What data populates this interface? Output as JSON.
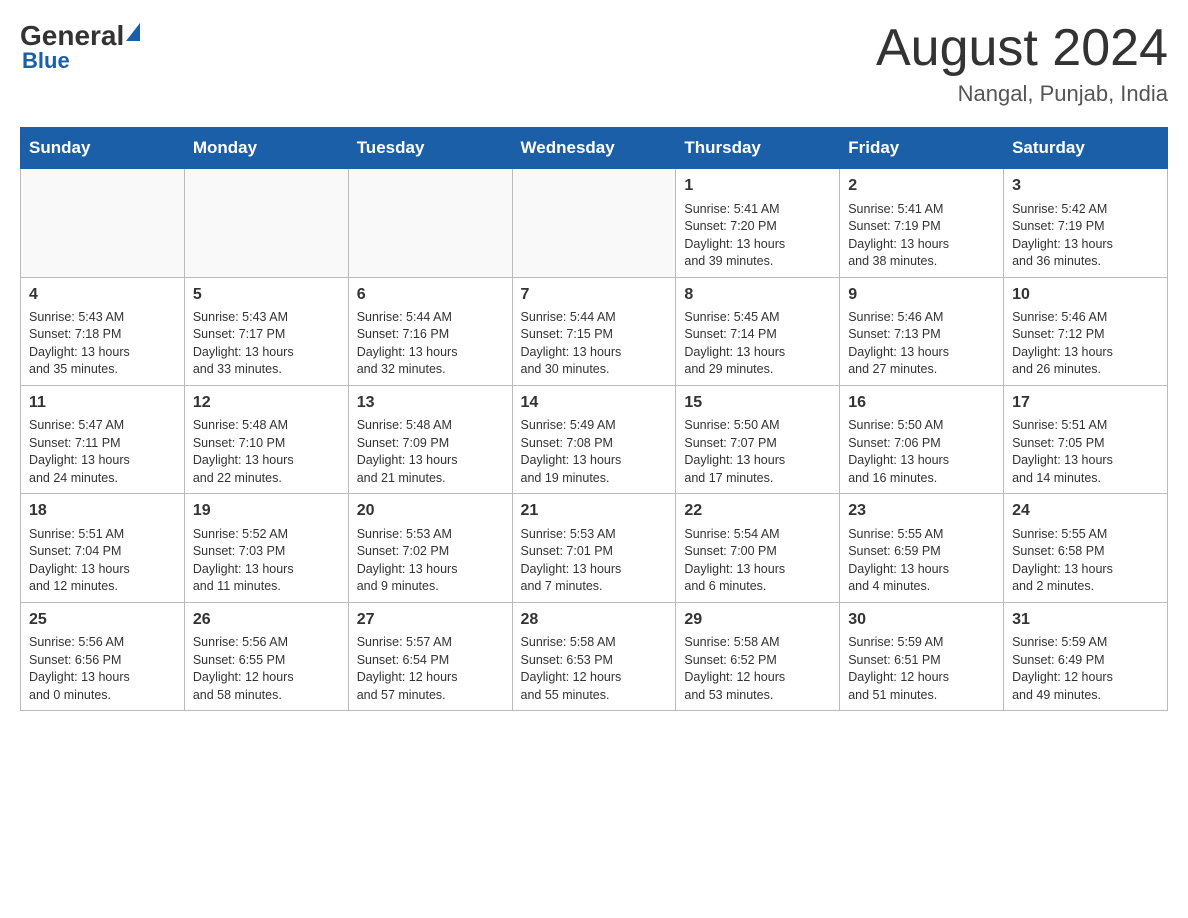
{
  "header": {
    "logo": {
      "general": "General",
      "blue": "Blue"
    },
    "title": "August 2024",
    "location": "Nangal, Punjab, India"
  },
  "calendar": {
    "days": [
      "Sunday",
      "Monday",
      "Tuesday",
      "Wednesday",
      "Thursday",
      "Friday",
      "Saturday"
    ],
    "weeks": [
      [
        {
          "day": "",
          "info": ""
        },
        {
          "day": "",
          "info": ""
        },
        {
          "day": "",
          "info": ""
        },
        {
          "day": "",
          "info": ""
        },
        {
          "day": "1",
          "info": "Sunrise: 5:41 AM\nSunset: 7:20 PM\nDaylight: 13 hours\nand 39 minutes."
        },
        {
          "day": "2",
          "info": "Sunrise: 5:41 AM\nSunset: 7:19 PM\nDaylight: 13 hours\nand 38 minutes."
        },
        {
          "day": "3",
          "info": "Sunrise: 5:42 AM\nSunset: 7:19 PM\nDaylight: 13 hours\nand 36 minutes."
        }
      ],
      [
        {
          "day": "4",
          "info": "Sunrise: 5:43 AM\nSunset: 7:18 PM\nDaylight: 13 hours\nand 35 minutes."
        },
        {
          "day": "5",
          "info": "Sunrise: 5:43 AM\nSunset: 7:17 PM\nDaylight: 13 hours\nand 33 minutes."
        },
        {
          "day": "6",
          "info": "Sunrise: 5:44 AM\nSunset: 7:16 PM\nDaylight: 13 hours\nand 32 minutes."
        },
        {
          "day": "7",
          "info": "Sunrise: 5:44 AM\nSunset: 7:15 PM\nDaylight: 13 hours\nand 30 minutes."
        },
        {
          "day": "8",
          "info": "Sunrise: 5:45 AM\nSunset: 7:14 PM\nDaylight: 13 hours\nand 29 minutes."
        },
        {
          "day": "9",
          "info": "Sunrise: 5:46 AM\nSunset: 7:13 PM\nDaylight: 13 hours\nand 27 minutes."
        },
        {
          "day": "10",
          "info": "Sunrise: 5:46 AM\nSunset: 7:12 PM\nDaylight: 13 hours\nand 26 minutes."
        }
      ],
      [
        {
          "day": "11",
          "info": "Sunrise: 5:47 AM\nSunset: 7:11 PM\nDaylight: 13 hours\nand 24 minutes."
        },
        {
          "day": "12",
          "info": "Sunrise: 5:48 AM\nSunset: 7:10 PM\nDaylight: 13 hours\nand 22 minutes."
        },
        {
          "day": "13",
          "info": "Sunrise: 5:48 AM\nSunset: 7:09 PM\nDaylight: 13 hours\nand 21 minutes."
        },
        {
          "day": "14",
          "info": "Sunrise: 5:49 AM\nSunset: 7:08 PM\nDaylight: 13 hours\nand 19 minutes."
        },
        {
          "day": "15",
          "info": "Sunrise: 5:50 AM\nSunset: 7:07 PM\nDaylight: 13 hours\nand 17 minutes."
        },
        {
          "day": "16",
          "info": "Sunrise: 5:50 AM\nSunset: 7:06 PM\nDaylight: 13 hours\nand 16 minutes."
        },
        {
          "day": "17",
          "info": "Sunrise: 5:51 AM\nSunset: 7:05 PM\nDaylight: 13 hours\nand 14 minutes."
        }
      ],
      [
        {
          "day": "18",
          "info": "Sunrise: 5:51 AM\nSunset: 7:04 PM\nDaylight: 13 hours\nand 12 minutes."
        },
        {
          "day": "19",
          "info": "Sunrise: 5:52 AM\nSunset: 7:03 PM\nDaylight: 13 hours\nand 11 minutes."
        },
        {
          "day": "20",
          "info": "Sunrise: 5:53 AM\nSunset: 7:02 PM\nDaylight: 13 hours\nand 9 minutes."
        },
        {
          "day": "21",
          "info": "Sunrise: 5:53 AM\nSunset: 7:01 PM\nDaylight: 13 hours\nand 7 minutes."
        },
        {
          "day": "22",
          "info": "Sunrise: 5:54 AM\nSunset: 7:00 PM\nDaylight: 13 hours\nand 6 minutes."
        },
        {
          "day": "23",
          "info": "Sunrise: 5:55 AM\nSunset: 6:59 PM\nDaylight: 13 hours\nand 4 minutes."
        },
        {
          "day": "24",
          "info": "Sunrise: 5:55 AM\nSunset: 6:58 PM\nDaylight: 13 hours\nand 2 minutes."
        }
      ],
      [
        {
          "day": "25",
          "info": "Sunrise: 5:56 AM\nSunset: 6:56 PM\nDaylight: 13 hours\nand 0 minutes."
        },
        {
          "day": "26",
          "info": "Sunrise: 5:56 AM\nSunset: 6:55 PM\nDaylight: 12 hours\nand 58 minutes."
        },
        {
          "day": "27",
          "info": "Sunrise: 5:57 AM\nSunset: 6:54 PM\nDaylight: 12 hours\nand 57 minutes."
        },
        {
          "day": "28",
          "info": "Sunrise: 5:58 AM\nSunset: 6:53 PM\nDaylight: 12 hours\nand 55 minutes."
        },
        {
          "day": "29",
          "info": "Sunrise: 5:58 AM\nSunset: 6:52 PM\nDaylight: 12 hours\nand 53 minutes."
        },
        {
          "day": "30",
          "info": "Sunrise: 5:59 AM\nSunset: 6:51 PM\nDaylight: 12 hours\nand 51 minutes."
        },
        {
          "day": "31",
          "info": "Sunrise: 5:59 AM\nSunset: 6:49 PM\nDaylight: 12 hours\nand 49 minutes."
        }
      ]
    ]
  }
}
